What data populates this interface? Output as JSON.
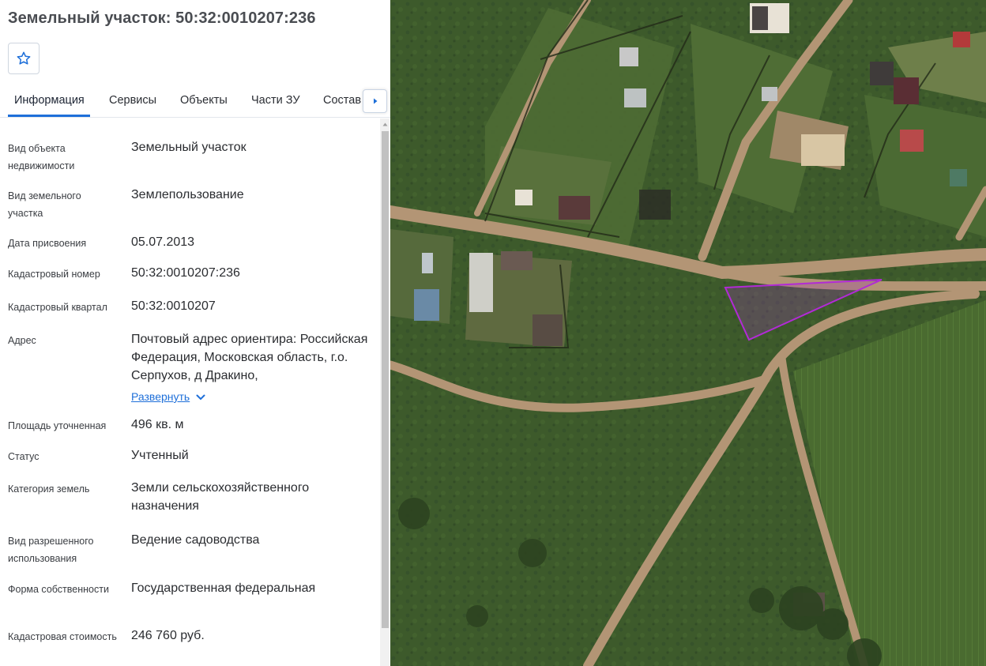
{
  "header": {
    "title": "Земельный участок: 50:32:0010207:236",
    "favorite_icon": "star-icon"
  },
  "tabs": [
    {
      "label": "Информация",
      "active": true
    },
    {
      "label": "Сервисы",
      "active": false
    },
    {
      "label": "Объекты",
      "active": false
    },
    {
      "label": "Части ЗУ",
      "active": false
    },
    {
      "label": "Состав",
      "active": false
    }
  ],
  "tab_scroll_icon": "chevron-right-icon",
  "info": {
    "rows": [
      {
        "label": "Вид объекта недвижимости",
        "value": "Земельный участок"
      },
      {
        "label": "Вид земельного участка",
        "value": "Землепользование"
      },
      {
        "label": "Дата присвоения",
        "value": "05.07.2013"
      },
      {
        "label": "Кадастровый номер",
        "value": "50:32:0010207:236"
      },
      {
        "label": "Кадастровый квартал",
        "value": "50:32:0010207"
      },
      {
        "label": "Адрес",
        "value": "Почтовый адрес ориентира: Российская Федерация, Московская область, г.о. Серпухов, д Дракино,",
        "expand_label": "Развернуть"
      },
      {
        "label": "Площадь уточненная",
        "value": "496 кв. м"
      },
      {
        "label": "Статус",
        "value": "Учтенный"
      },
      {
        "label": "Категория земель",
        "value": "Земли сельскохозяйственного назначения"
      },
      {
        "label": "Вид разрешенного использования",
        "value": "Ведение садоводства"
      },
      {
        "label": "Форма собственности",
        "value": "Государственная федеральная"
      },
      {
        "label": "Кадастровая стоимость",
        "value": "246 760 руб."
      }
    ]
  },
  "colors": {
    "accent": "#1e6fd9",
    "parcel_outline": "#b22ad6"
  }
}
